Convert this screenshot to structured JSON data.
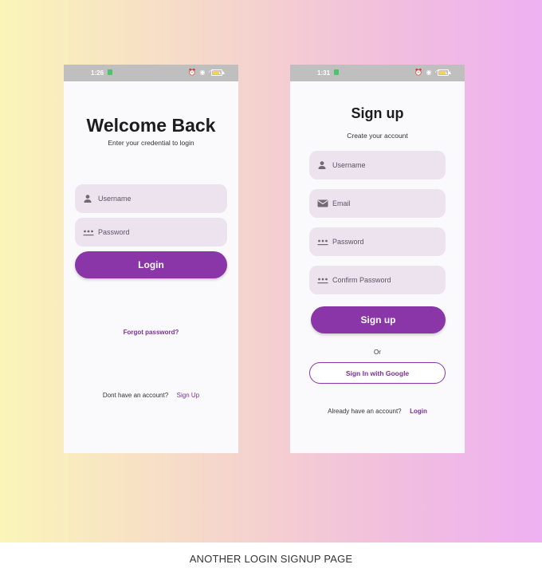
{
  "login_screen": {
    "status_time": "1:26",
    "title": "Welcome Back",
    "subtitle": "Enter your credential to login",
    "username_placeholder": "Username",
    "password_placeholder": "Password",
    "login_button": "Login",
    "forgot_password": "Forgot password?",
    "no_account_text": "Dont have an account?",
    "signup_link": "Sign Up"
  },
  "signup_screen": {
    "status_time": "1:31",
    "title": "Sign up",
    "subtitle": "Create your account",
    "username_placeholder": "Username",
    "email_placeholder": "Email",
    "password_placeholder": "Password",
    "confirm_password_placeholder": "Confirm Password",
    "signup_button": "Sign up",
    "or_text": "Or",
    "google_button": "Sign In with Google",
    "have_account_text": "Already have an account?",
    "login_link": "Login"
  },
  "caption": "ANOTHER LOGIN SIGNUP PAGE",
  "colors": {
    "accent": "#8a35a8",
    "field_bg": "#ede3ef",
    "statusbar": "#bfbfbf"
  },
  "icons": [
    "person-icon",
    "password-dots-icon",
    "mail-icon",
    "battery-icon",
    "notification-icon"
  ]
}
